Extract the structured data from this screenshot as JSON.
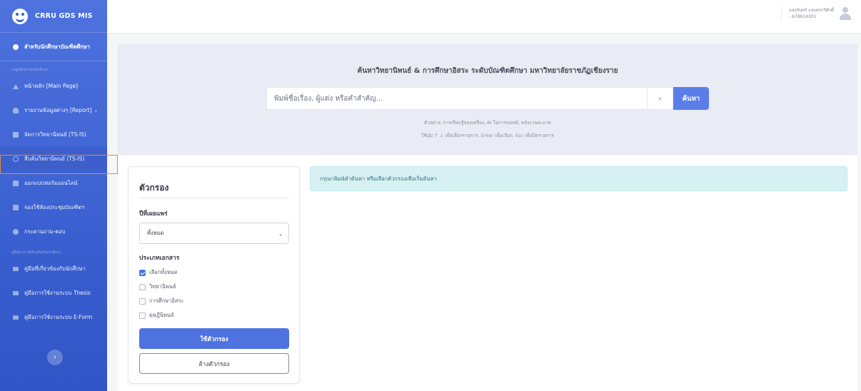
{
  "brand": {
    "name": "CRRU GDS MIS"
  },
  "sidebar": {
    "main_item": "สำหรับนักศึกษาบัณฑิตศึกษา",
    "section1_heading": "เมนูหลักสำหรับนักศึกษา",
    "items": [
      {
        "label": "หน้าหลัก [Main Page]",
        "icon": "home-icon"
      },
      {
        "label": "รายงานข้อมูลต่างๆ [Report]",
        "icon": "user-icon"
      },
      {
        "label": "จัดการวิทยานิพนธ์ (TS-IS)",
        "icon": "document-icon"
      },
      {
        "label": "สืบค้นวิทยานิพนธ์ (TS-IS)",
        "icon": "search-icon"
      },
      {
        "label": "ออกแบบฟอร์มออนไลน์",
        "icon": "file-icon"
      },
      {
        "label": "จองใช้ห้องประชุมบัณฑิตฯ",
        "icon": "edit-icon"
      },
      {
        "label": "กระดานถาม-ตอบ",
        "icon": "chat-icon"
      }
    ],
    "section2_heading": "คู่มือต่างๆ ที่เกี่ยวข้องกับนักศึกษา",
    "manuals": [
      {
        "label": "คู่มือที่เกี่ยวข้องกับนักศึกษา",
        "icon": "folder-icon"
      },
      {
        "label": "คู่มือการใช้งานระบบ Thesis",
        "icon": "folder-icon"
      },
      {
        "label": "คู่มือการใช้งานระบบ E-Form",
        "icon": "folder-icon"
      }
    ],
    "collapse_glyph": "‹"
  },
  "topbar": {
    "user_name": "แสงจันทร์ แสงสรกวีศักดิ์",
    "user_id": "- 678914001"
  },
  "search": {
    "title": "ค้นหาวิทยานิพนธ์ & การศึกษาอิสระ ระดับบัณฑิตศึกษา มหาวิทยาลัยราชภัฏเชียงราย",
    "placeholder": "พิมพ์ชื่อเรื่อง, ผู้แต่ง หรือคำสำคัญ...",
    "clear_glyph": "×",
    "button_label": "ค้นหา",
    "example_hint": "ตัวอย่าง: การเรียนรู้ของเครื่อง, AI ในการแพทย์, พลังงานสะอาด",
    "keyboard_hint": "ใช้ปุ่ม ↑ ↓ เพื่อเลือกรายการ, Enter เพื่อเลือก, Esc เพื่อปิดรายการ"
  },
  "filter": {
    "title": "ตัวกรอง",
    "year_label": "ปีที่เผยแพร่",
    "year_value": "ทั้งหมด",
    "doctype_label": "ประเภทเอกสาร",
    "options": [
      {
        "label": "เลือกทั้งหมด",
        "checked": true
      },
      {
        "label": "วิทยานิพนธ์",
        "checked": false
      },
      {
        "label": "การศึกษาอิสระ",
        "checked": false
      },
      {
        "label": "ดุษฎีนิพนธ์",
        "checked": false
      }
    ],
    "apply_label": "ใช้ตัวกรอง",
    "clear_label": "ล้างตัวกรอง"
  },
  "results": {
    "info_message": "กรุณาพิมพ์คำค้นหา หรือเลือกตัวกรองเพื่อเริ่มค้นหา"
  },
  "colors": {
    "sidebar": "#4e73df",
    "primary_button": "#4e73df",
    "info_bg": "#d7f1f3",
    "highlight": "#e08a4e"
  }
}
